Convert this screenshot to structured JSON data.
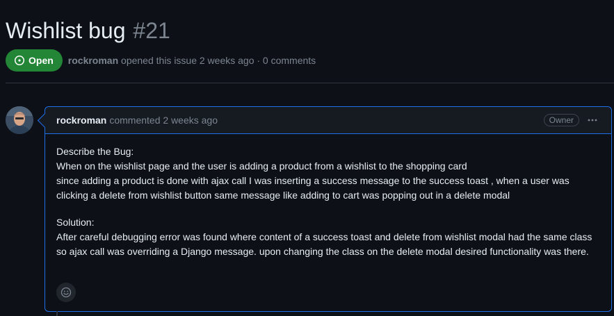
{
  "issue": {
    "title": "Wishlist bug",
    "number": "#21",
    "state": "Open",
    "author": "rockroman",
    "opened_text": "opened this issue 2 weeks ago · 0 comments"
  },
  "comment": {
    "author": "rockroman",
    "time": "commented 2 weeks ago",
    "badge": "Owner",
    "body": {
      "bug_heading": "Describe the Bug:",
      "bug_line1": "When on the wishlist page and the user is adding a product from a wishlist to the shopping card",
      "bug_line2": "since adding a product is done with ajax call I was inserting a success message to the success toast , when a user was clicking a delete from wishlist button same message like adding to cart was popping out in a delete modal",
      "solution_heading": "Solution:",
      "solution_text": "After careful debugging error was found where content of a success toast and delete from wishlist modal had the same class so ajax call was overriding a Django message. upon changing the class on the delete modal desired functionality was there."
    }
  },
  "colors": {
    "open_green": "#238636",
    "accent_blue": "#1f6feb",
    "muted_text": "#7d8590",
    "background": "#0d1117"
  },
  "icons": [
    "issue-opened-icon",
    "kebab-horizontal-icon",
    "smiley-icon",
    "avatar"
  ]
}
